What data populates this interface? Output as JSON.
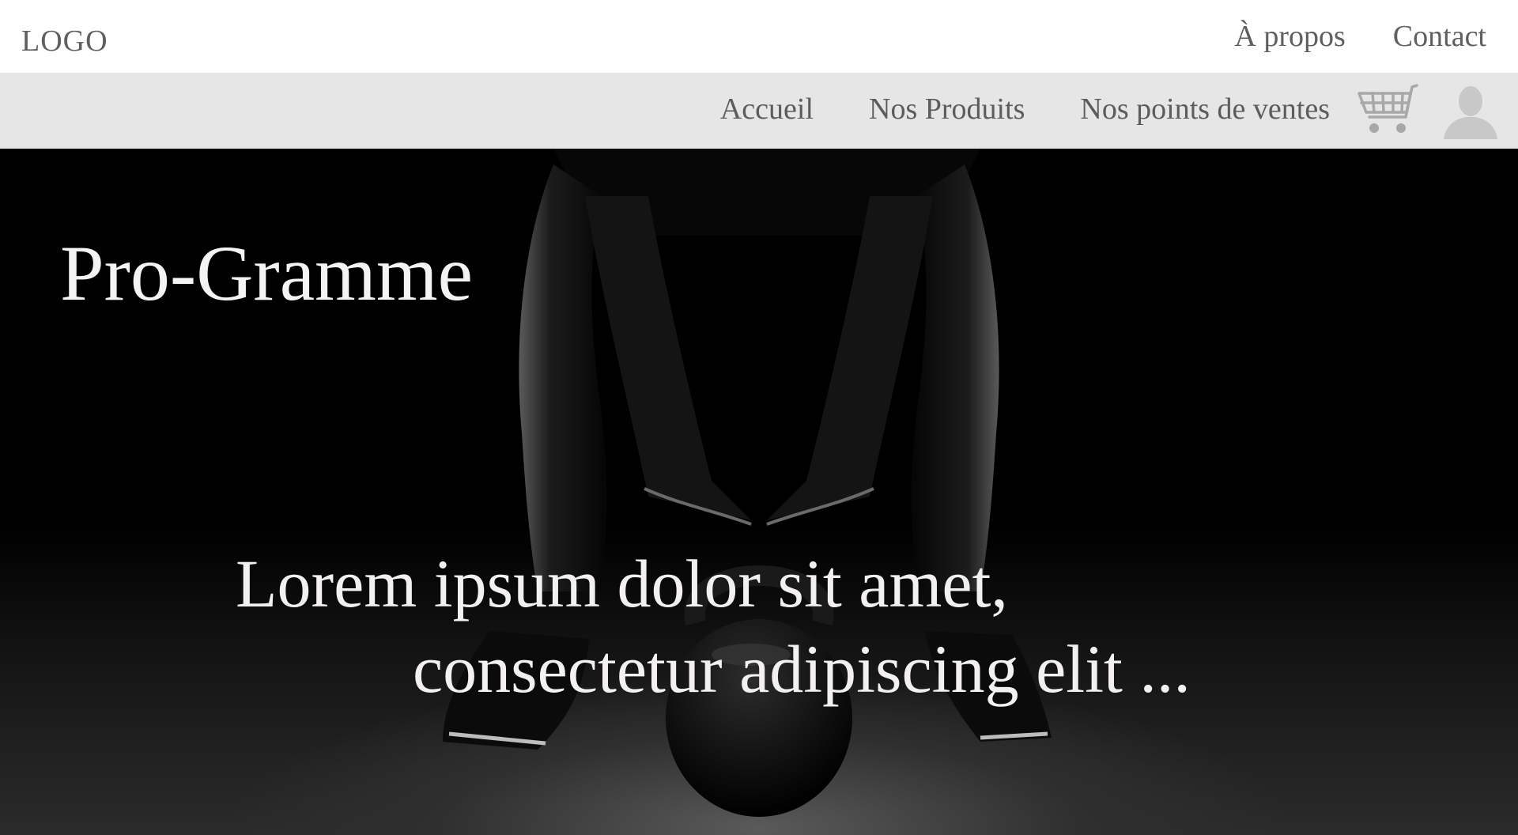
{
  "header": {
    "logo": "LOGO",
    "links": [
      "À propos",
      "Contact"
    ]
  },
  "nav": {
    "items": [
      "Accueil",
      "Nos Produits",
      "Nos points de ventes"
    ],
    "icons": [
      "cart-icon",
      "user-avatar-icon"
    ]
  },
  "hero": {
    "title": "Pro-Gramme",
    "tagline_line1": "Lorem ipsum dolor sit amet,",
    "tagline_line2": "consectetur adipiscing elit ..."
  },
  "colors": {
    "nav_background": "#e6e6e6",
    "link_text": "#5f5f5f",
    "hero_text": "#f4f4f4"
  }
}
